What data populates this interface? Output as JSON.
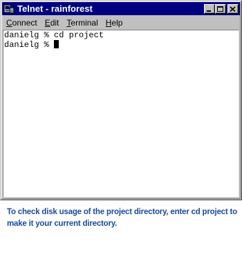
{
  "window": {
    "title": "Telnet - rainforest",
    "icon": "telnet-terminal-icon",
    "title_bar_color": "#000080"
  },
  "title_buttons": {
    "minimize_icon": "minimize-icon",
    "maximize_icon": "maximize-icon",
    "close_icon": "close-icon"
  },
  "menu": {
    "items": [
      {
        "accel": "C",
        "rest": "onnect"
      },
      {
        "accel": "E",
        "rest": "dit"
      },
      {
        "accel": "T",
        "rest": "erminal"
      },
      {
        "accel": "H",
        "rest": "elp"
      }
    ]
  },
  "terminal": {
    "lines": [
      "danielg % cd project",
      "danielg % "
    ],
    "cursor": true
  },
  "caption": {
    "text": "To check disk usage of the project directory, enter cd project to make it your current directory.",
    "color": "#1a4a9c"
  }
}
